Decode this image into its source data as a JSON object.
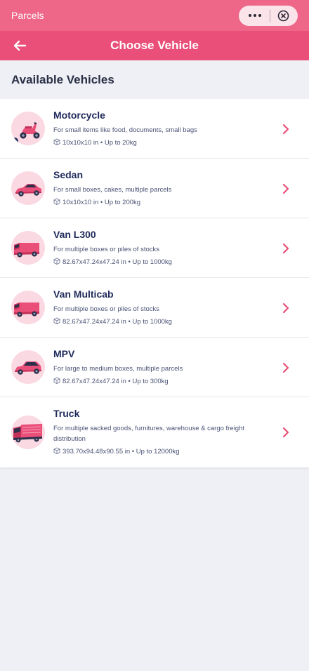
{
  "app": {
    "title": "Parcels"
  },
  "capsule": {
    "more_icon": "more-dots-icon",
    "close_icon": "close-circle-icon"
  },
  "header": {
    "title": "Choose Vehicle",
    "back_icon": "arrow-left-icon"
  },
  "section": {
    "title": "Available Vehicles"
  },
  "vehicles": [
    {
      "name": "Motorcycle",
      "description": "For small items like food, documents, small bags",
      "specs": "10x10x10 in • Up to 20kg",
      "icon": "motorcycle-icon"
    },
    {
      "name": "Sedan",
      "description": "For small boxes, cakes, multiple parcels",
      "specs": "10x10x10 in • Up to 200kg",
      "icon": "sedan-icon"
    },
    {
      "name": "Van L300",
      "description": "For multiple boxes or piles of stocks",
      "specs": "82.67x47.24x47.24 in • Up to 1000kg",
      "icon": "van-icon"
    },
    {
      "name": "Van Multicab",
      "description": "For multiple boxes or piles of stocks",
      "specs": "82.67x47.24x47.24 in • Up to 1000kg",
      "icon": "van-icon"
    },
    {
      "name": "MPV",
      "description": "For large to medium boxes, multiple parcels",
      "specs": "82.67x47.24x47.24 in • Up to 300kg",
      "icon": "mpv-icon"
    },
    {
      "name": "Truck",
      "description": "For multiple sacked goods, furnitures, warehouse & cargo freight distribution",
      "specs": "393.70x94.48x90.55 in • Up to 12000kg",
      "icon": "truck-icon"
    }
  ],
  "colors": {
    "status_bar": "#ee6688",
    "nav_bar": "#e94f78",
    "accent": "#e94f78",
    "background": "#eef0f5"
  }
}
